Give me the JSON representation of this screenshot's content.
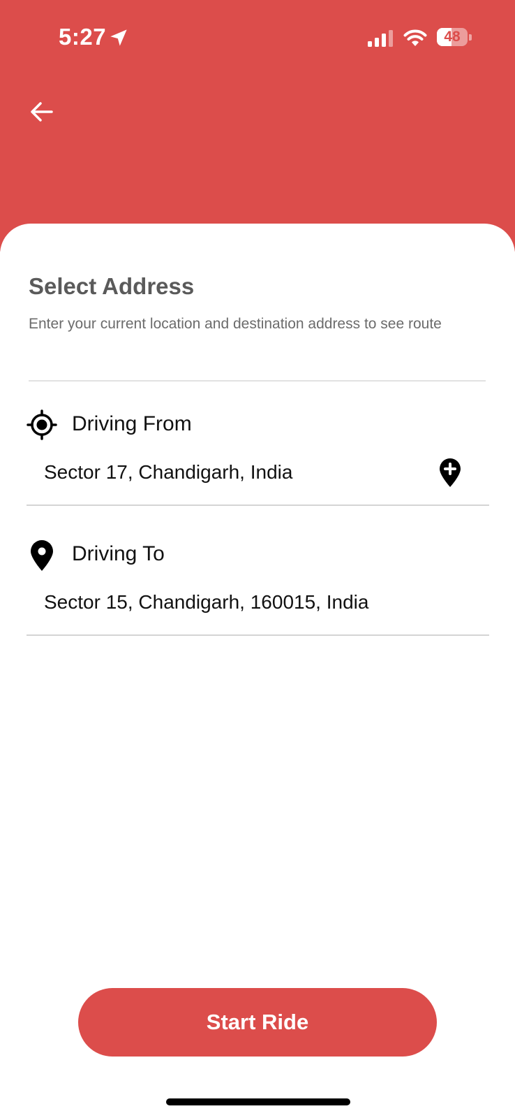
{
  "colors": {
    "brand_red": "#DC4D4B",
    "background": "#FFFFFF",
    "title_gray": "#5A5A5A",
    "text_dark": "#111111"
  },
  "status_bar": {
    "time": "5:27",
    "battery": "48",
    "battery_level": 0.48,
    "icons": [
      "location-arrow-icon",
      "signal-icon",
      "wifi-icon",
      "battery-icon"
    ]
  },
  "header": {
    "back_icon": "arrow-left-icon"
  },
  "address_form": {
    "title": "Select Address",
    "subtitle": "Enter your current location and destination address to see route",
    "from": {
      "label": "Driving From",
      "icon": "crosshair-icon",
      "value": "Sector 17, Chandigarh, India",
      "action_icon": "add-location-pin-icon"
    },
    "to": {
      "label": "Driving To",
      "icon": "location-pin-icon",
      "value": "Sector 15, Chandigarh, 160015, India"
    }
  },
  "actions": {
    "start_ride_label": "Start Ride"
  }
}
